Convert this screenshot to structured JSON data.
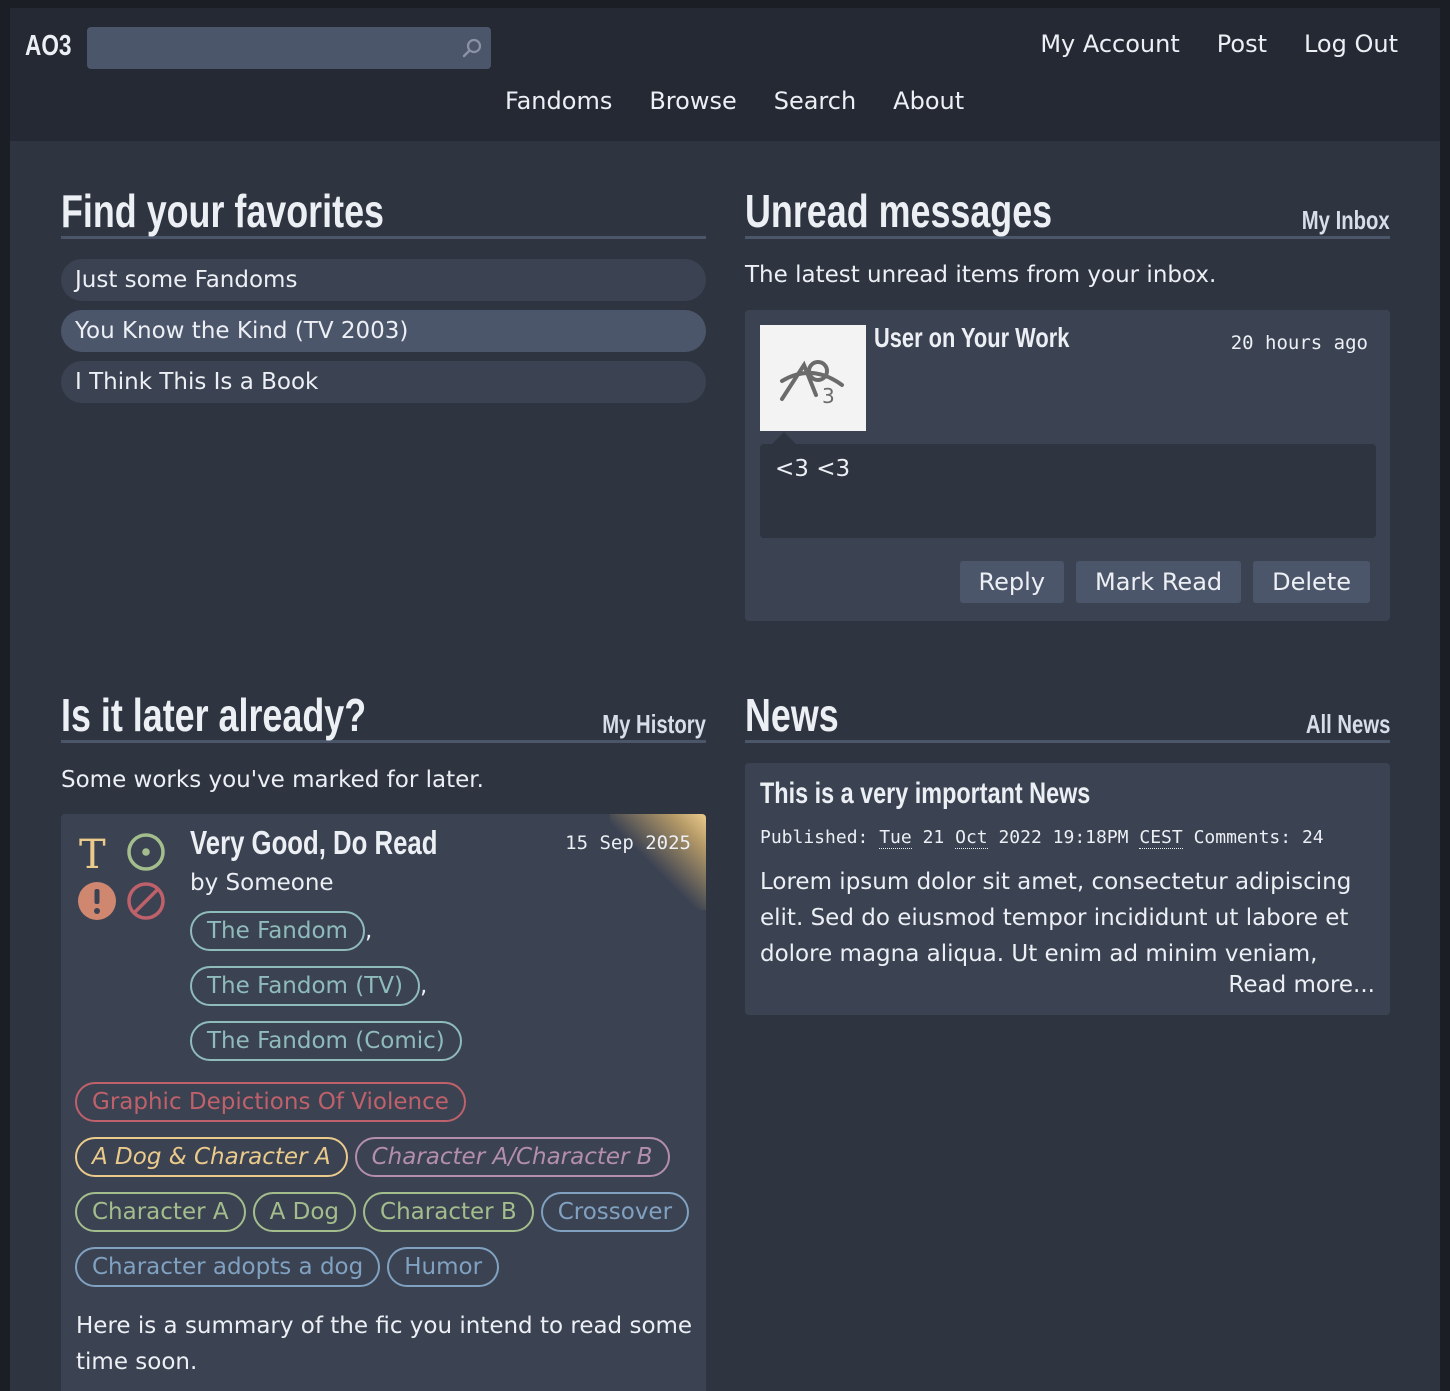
{
  "header": {
    "logo": "AO3",
    "search_placeholder": "",
    "user_nav": [
      "My Account",
      "Post",
      "Log Out"
    ],
    "main_nav": [
      "Fandoms",
      "Browse",
      "Search",
      "About"
    ]
  },
  "favorites": {
    "title": "Find your favorites",
    "items": [
      "Just some Fandoms",
      "You Know the Kind (TV 2003)",
      "I Think This Is a Book"
    ]
  },
  "messages": {
    "title": "Unread messages",
    "link": "My Inbox",
    "intro": "The latest unread items from your inbox.",
    "item": {
      "from": "User on Your Work",
      "time": "20 hours ago",
      "body": "<3 <3",
      "buttons": [
        "Reply",
        "Mark Read",
        "Delete"
      ]
    }
  },
  "later": {
    "title": "Is it later already?",
    "link": "My History",
    "intro": "Some works you've marked for later.",
    "work": {
      "title": "Very Good, Do Read",
      "date": "15 Sep 2025",
      "byline": "by Someone",
      "fandoms": [
        "The Fandom",
        "The Fandom (TV)",
        "The Fandom (Comic)"
      ],
      "warnings": [
        "Graphic Depictions Of Violence"
      ],
      "relationships": [
        "A Dog & Character A",
        "Character A/Character B"
      ],
      "characters": [
        "Character A",
        "A Dog",
        "Character B"
      ],
      "freeforms": [
        "Crossover",
        "Character adopts a dog",
        "Humor"
      ],
      "summary": "Here is a summary of the fic you intend to read some time soon.",
      "rating_symbol": "T"
    }
  },
  "news": {
    "title": "News",
    "link": "All News",
    "item": {
      "title": "This is a very important News",
      "published_label": "Published:",
      "weekday": "Tue",
      "day": "21",
      "month": "Oct",
      "year_time": "2022 19:18PM",
      "tz": "CEST",
      "comments_label": "Comments:",
      "comments": "24",
      "body": "Lorem ipsum dolor sit amet, consectetur adipiscing elit. Sed do eiusmod tempor incididunt ut labore et dolore magna aliqua. Ut enim ad minim veniam,",
      "read_more": "Read more..."
    }
  },
  "colors": {
    "bg": "#2e3440",
    "topbar": "#242933",
    "card": "#3b4252",
    "accent": "#4c566a",
    "fandom": "#8fbcbb",
    "warning": "#bf616a",
    "relationship": "#ebcb8b",
    "relationship_alt": "#b48ead",
    "character": "#a3be8c",
    "freeform": "#81a1c1"
  }
}
